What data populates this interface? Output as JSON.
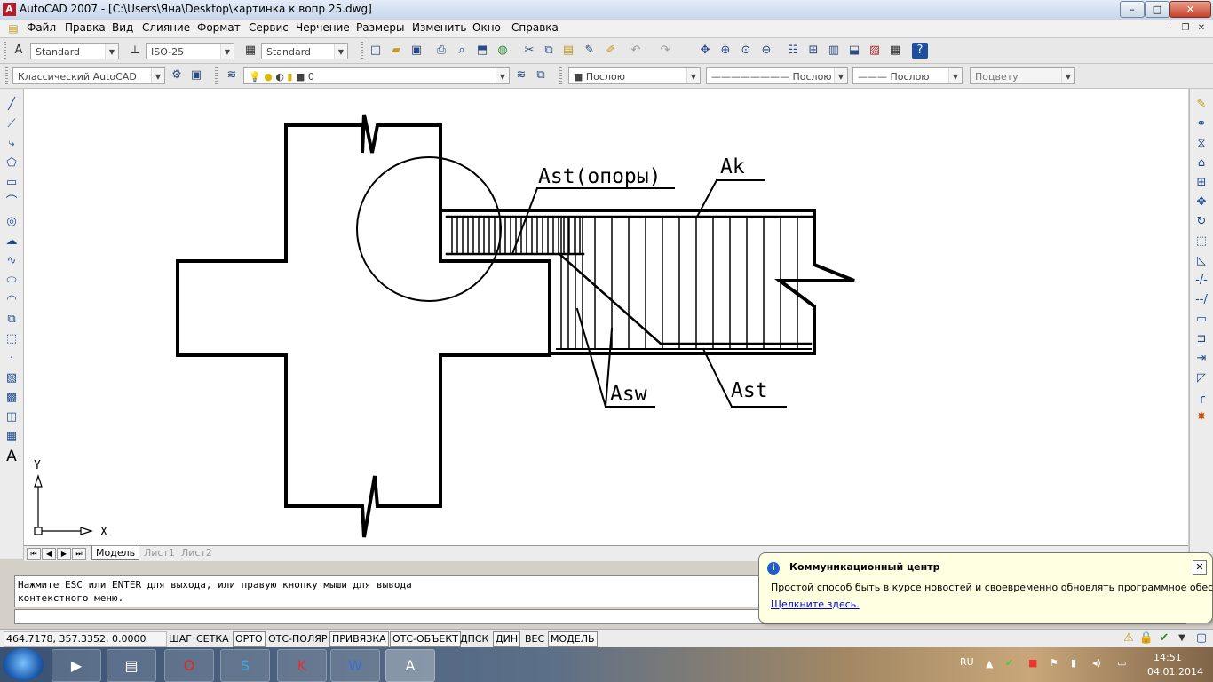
{
  "window": {
    "app_title": "AutoCAD 2007 - ",
    "doc_title": "[C:\\Users\\Яна\\Desktop\\картинка к вопр 25.dwg]",
    "minimize": "–",
    "maximize": "□",
    "close": "✕"
  },
  "menu": [
    "Файл",
    "Правка",
    "Вид",
    "Слияние",
    "Формат",
    "Сервис",
    "Черчение",
    "Размеры",
    "Изменить",
    "Окно",
    "Справка"
  ],
  "toolbar1": {
    "text_style": "Standard",
    "dim_style": "ISO-25",
    "table_style": "Standard"
  },
  "toolbar2": {
    "workspace": "Классический AutoCAD",
    "layer": "0",
    "color": "Послою",
    "linetype": "Послою",
    "lineweight": "Послою",
    "plotstyle": "Поцвету"
  },
  "drawing": {
    "labels": {
      "ast_supports": "Ast(опоры)",
      "ak": "Ak",
      "asw": "Asw",
      "ast": "Ast"
    },
    "ucs": {
      "y": "Y",
      "x": "X"
    }
  },
  "layout_tabs": {
    "model": "Модель",
    "sheet1": "Лист1",
    "sheet2": "Лист2"
  },
  "command": {
    "history": "Нажмите ESC или ENTER для выхода, или правую кнопку мыши для вывода\nконтекстного меню.",
    "input": ""
  },
  "status": {
    "coords": "464.7178, 357.3352, 0.0000",
    "toggles": [
      {
        "label": "ШАГ",
        "on": false
      },
      {
        "label": "СЕТКА",
        "on": false
      },
      {
        "label": "ОРТО",
        "on": true
      },
      {
        "label": "ОТС-ПОЛЯР",
        "on": false
      },
      {
        "label": "ПРИВЯЗКА",
        "on": true
      },
      {
        "label": "ОТС-ОБЪЕКТ",
        "on": true
      },
      {
        "label": "ДПСК",
        "on": false
      },
      {
        "label": "ДИН",
        "on": true
      },
      {
        "label": "ВЕС",
        "on": false
      },
      {
        "label": "МОДЕЛЬ",
        "on": true
      }
    ]
  },
  "balloon": {
    "title": "Коммуникационный центр",
    "message": "Простой способ быть в курсе новостей и своевременно обновлять программное обеспечение.",
    "link": "Щелкните здесь.",
    "close": "✕"
  },
  "taskbar": {
    "lang": "RU",
    "time": "14:51",
    "date": "04.01.2014"
  },
  "colors": {
    "canvas": "#ffffff",
    "ui": "#d4d0c8",
    "balloon": "#ffffe1"
  }
}
